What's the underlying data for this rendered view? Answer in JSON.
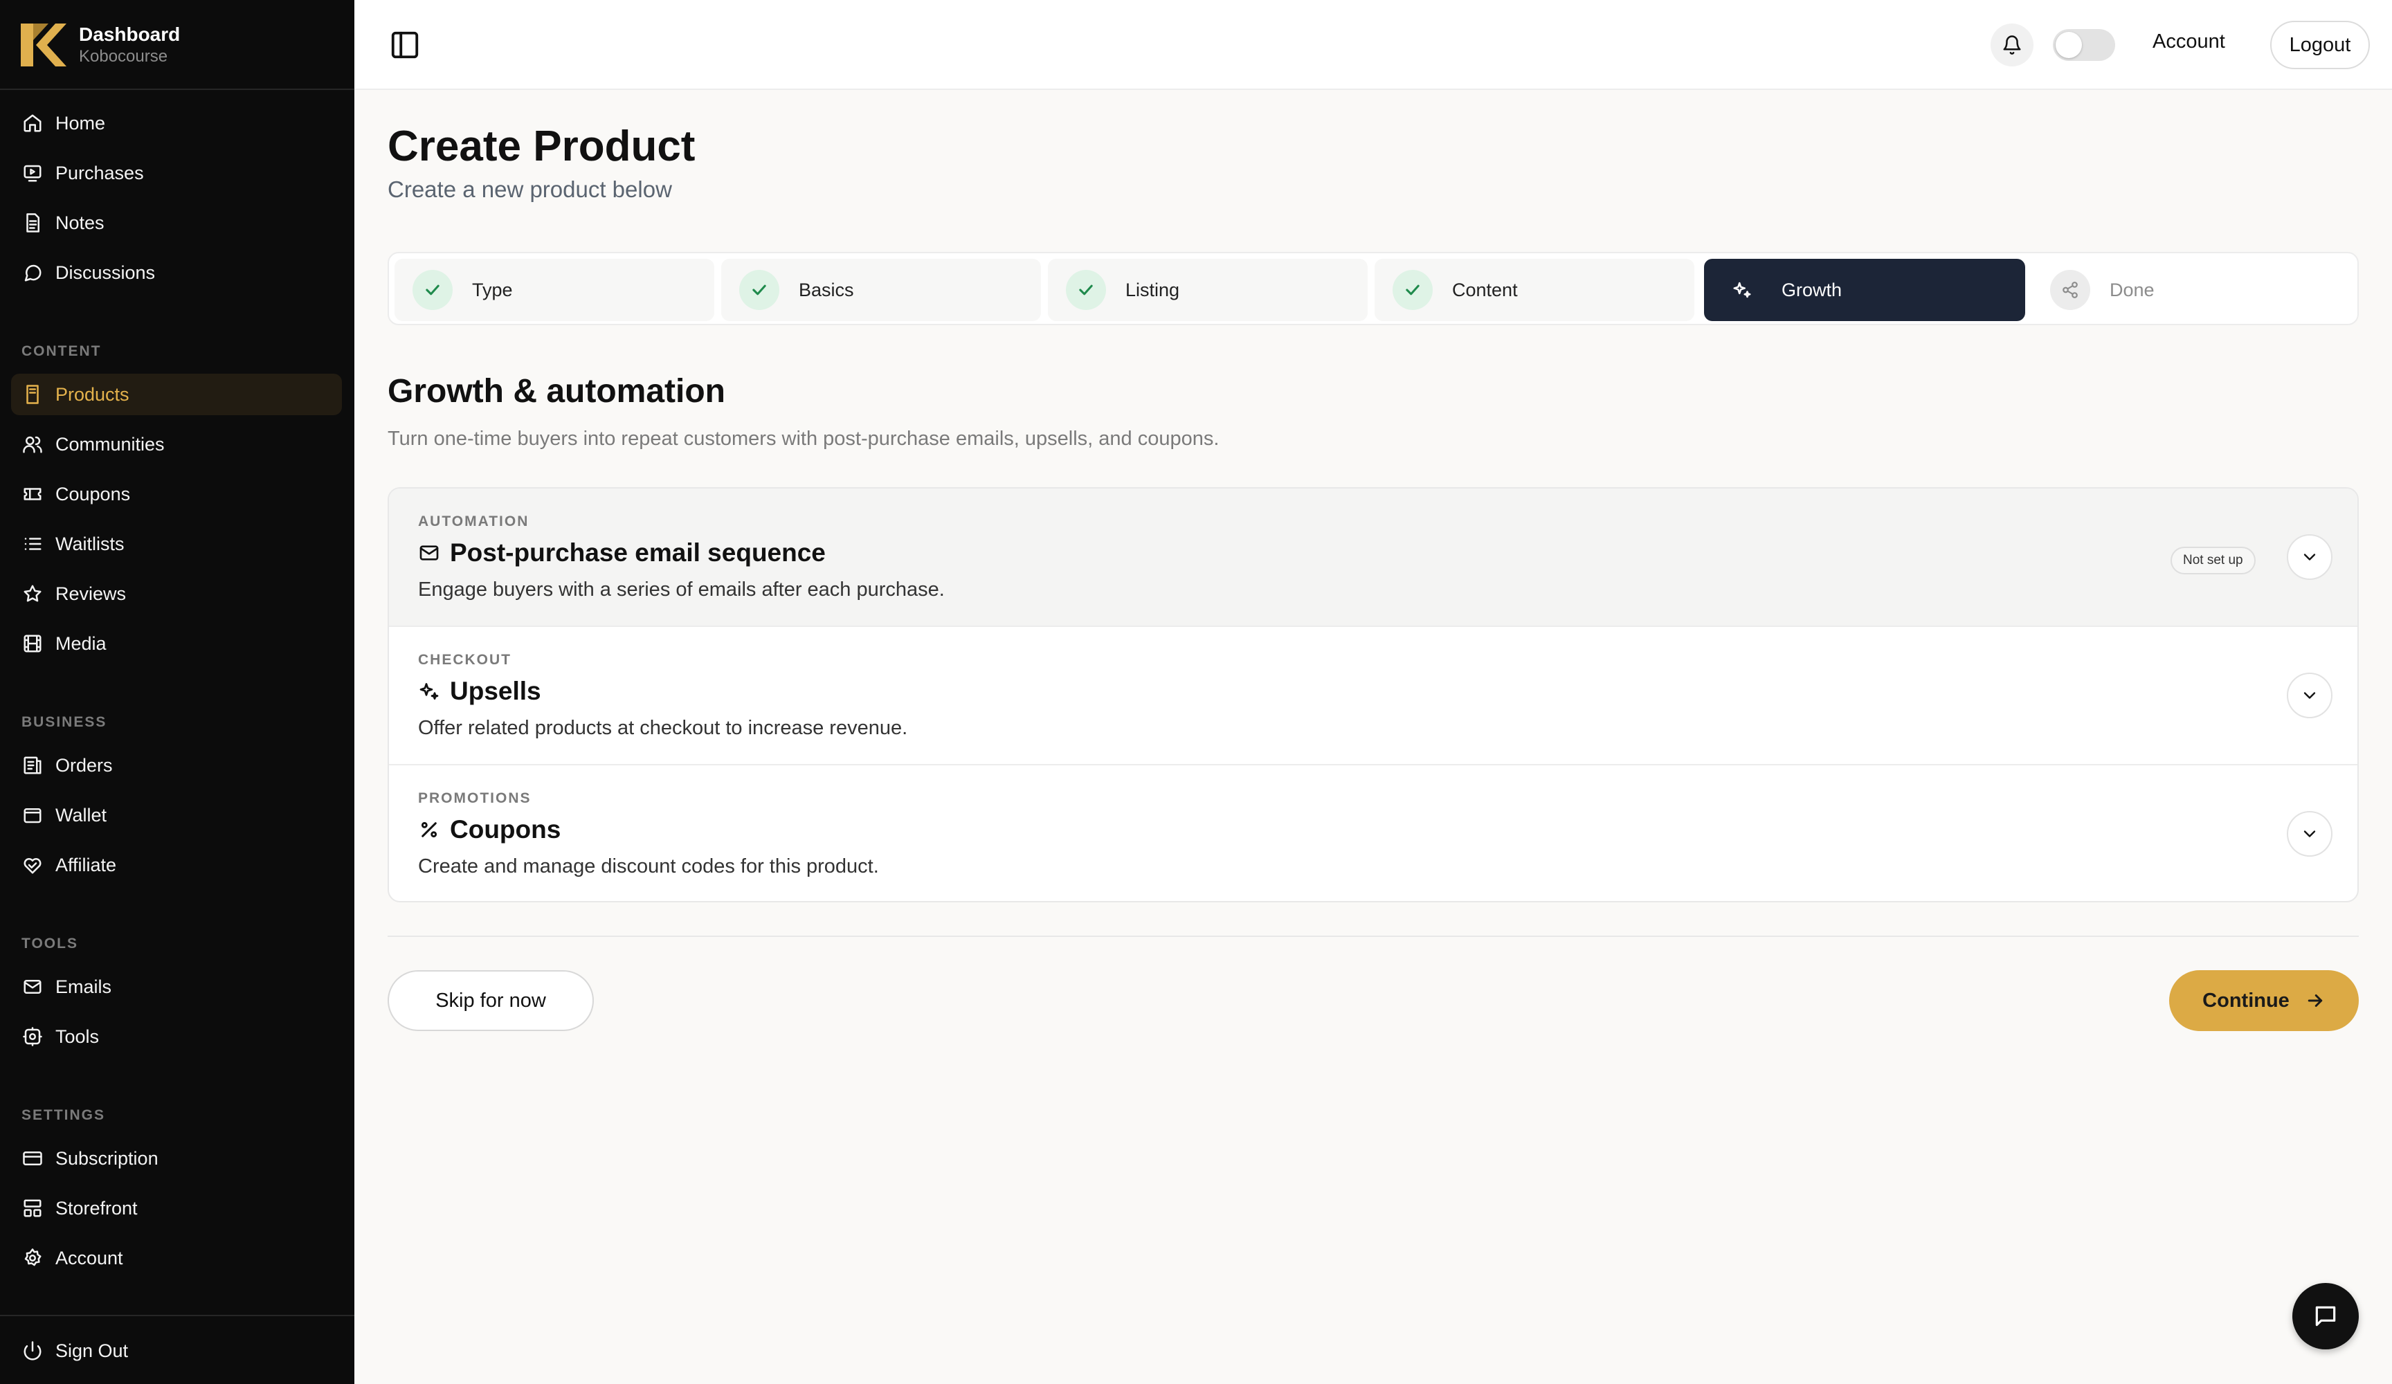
{
  "brand": {
    "title": "Dashboard",
    "subtitle": "Kobocourse"
  },
  "sidebar": {
    "main": [
      {
        "label": "Home",
        "icon": "home-icon"
      },
      {
        "label": "Purchases",
        "icon": "purchases-icon"
      },
      {
        "label": "Notes",
        "icon": "notes-icon"
      },
      {
        "label": "Discussions",
        "icon": "discussions-icon"
      }
    ],
    "content_label": "CONTENT",
    "content": [
      {
        "label": "Products",
        "icon": "products-icon",
        "active": true
      },
      {
        "label": "Communities",
        "icon": "communities-icon"
      },
      {
        "label": "Coupons",
        "icon": "coupons-icon"
      },
      {
        "label": "Waitlists",
        "icon": "waitlists-icon"
      },
      {
        "label": "Reviews",
        "icon": "star-icon"
      },
      {
        "label": "Media",
        "icon": "media-icon"
      }
    ],
    "business_label": "BUSINESS",
    "business": [
      {
        "label": "Orders",
        "icon": "orders-icon"
      },
      {
        "label": "Wallet",
        "icon": "wallet-icon"
      },
      {
        "label": "Affiliate",
        "icon": "affiliate-icon"
      }
    ],
    "tools_label": "TOOLS",
    "tools": [
      {
        "label": "Emails",
        "icon": "mail-icon"
      },
      {
        "label": "Tools",
        "icon": "tools-icon"
      }
    ],
    "settings_label": "SETTINGS",
    "settings": [
      {
        "label": "Subscription",
        "icon": "card-icon"
      },
      {
        "label": "Storefront",
        "icon": "storefront-icon"
      },
      {
        "label": "Account",
        "icon": "gear-icon"
      }
    ],
    "signout": "Sign Out"
  },
  "topbar": {
    "account": "Account",
    "logout": "Logout"
  },
  "page": {
    "title": "Create Product",
    "subtitle": "Create a new product below"
  },
  "steps": [
    {
      "label": "Type",
      "state": "done"
    },
    {
      "label": "Basics",
      "state": "done"
    },
    {
      "label": "Listing",
      "state": "done"
    },
    {
      "label": "Content",
      "state": "done"
    },
    {
      "label": "Growth",
      "state": "active"
    },
    {
      "label": "Done",
      "state": "pending"
    }
  ],
  "section": {
    "title": "Growth & automation",
    "description": "Turn one-time buyers into repeat customers with post-purchase emails, upsells, and coupons."
  },
  "panels": [
    {
      "eyebrow": "AUTOMATION",
      "title": "Post-purchase email sequence",
      "description": "Engage buyers with a series of emails after each purchase.",
      "badge": "Not set up",
      "icon": "mail-icon"
    },
    {
      "eyebrow": "CHECKOUT",
      "title": "Upsells",
      "description": "Offer related products at checkout to increase revenue.",
      "icon": "sparkles-icon"
    },
    {
      "eyebrow": "PROMOTIONS",
      "title": "Coupons",
      "description": "Create and manage discount codes for this product.",
      "icon": "percent-icon"
    }
  ],
  "actions": {
    "skip": "Skip for now",
    "continue": "Continue"
  },
  "colors": {
    "sidebar_bg": "#0c0c0c",
    "accent": "#dcaa45",
    "active_step": "#1c2537",
    "check": "#1f8a4c"
  }
}
